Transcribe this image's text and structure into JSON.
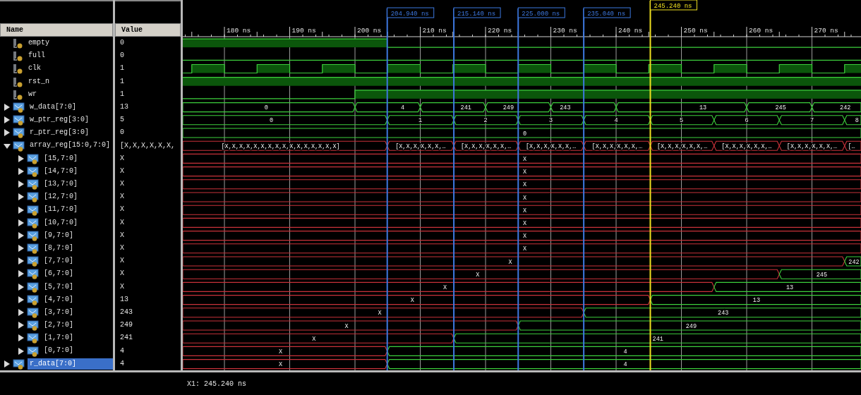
{
  "columns": {
    "name": "Name",
    "value": "Value"
  },
  "ruler": {
    "ticks": [
      "180 ns",
      "190 ns",
      "200 ns",
      "210 ns",
      "220 ns",
      "230 ns",
      "240 ns",
      "250 ns",
      "260 ns",
      "270 ns"
    ]
  },
  "markers": [
    {
      "label": "204.940 ns",
      "kind": "marker"
    },
    {
      "label": "215.140 ns",
      "kind": "marker"
    },
    {
      "label": "225.000 ns",
      "kind": "marker"
    },
    {
      "label": "235.040 ns",
      "kind": "marker"
    },
    {
      "label": "245.240 ns",
      "kind": "cursor"
    }
  ],
  "signals": [
    {
      "name": "empty",
      "kind": "bit",
      "value": "0",
      "selected": false
    },
    {
      "name": "full",
      "kind": "bit",
      "value": "0",
      "selected": false
    },
    {
      "name": "clk",
      "kind": "bit",
      "value": "1",
      "selected": false
    },
    {
      "name": "rst_n",
      "kind": "bit",
      "value": "1",
      "selected": false
    },
    {
      "name": "wr",
      "kind": "bit",
      "value": "1",
      "selected": false
    },
    {
      "name": "w_data[7:0]",
      "kind": "bus",
      "value": "13",
      "expanded": false,
      "selected": false,
      "labels": [
        "0",
        "4",
        "241",
        "249",
        "243",
        "13",
        "245",
        "242"
      ]
    },
    {
      "name": "w_ptr_reg[3:0]",
      "kind": "bus",
      "value": "5",
      "expanded": false,
      "selected": false,
      "labels": [
        "0",
        "1",
        "2",
        "3",
        "4",
        "5",
        "6",
        "7",
        "8"
      ]
    },
    {
      "name": "r_ptr_reg[3:0]",
      "kind": "bus",
      "value": "0",
      "expanded": false,
      "selected": false,
      "labels": [
        "0"
      ]
    },
    {
      "name": "array_reg[15:0,7:0]",
      "kind": "bus",
      "value": "[X,X,X,X,X,X,",
      "expanded": true,
      "selected": false,
      "labels": [
        "[X,X,X,X,X,X,X,X,X,X,X,X,X,X,X,X]",
        "[X,X,X,X,X,X,…",
        "[X,X,X,X,X,X,…",
        "[X,X,X,X,X,X,…",
        "[X,X,X,X,X,X,…",
        "[X,X,X,X,X,X,…",
        "[X,X,X,X,X,X,…",
        "[X,X,X,X,X,X,…",
        "[…"
      ],
      "children": [
        {
          "name": "[15,7:0]",
          "kind": "bus",
          "value": "X",
          "expanded": false,
          "selected": false,
          "labels": [
            "X"
          ]
        },
        {
          "name": "[14,7:0]",
          "kind": "bus",
          "value": "X",
          "expanded": false,
          "selected": false,
          "labels": [
            "X"
          ]
        },
        {
          "name": "[13,7:0]",
          "kind": "bus",
          "value": "X",
          "expanded": false,
          "selected": false,
          "labels": [
            "X"
          ]
        },
        {
          "name": "[12,7:0]",
          "kind": "bus",
          "value": "X",
          "expanded": false,
          "selected": false,
          "labels": [
            "X"
          ]
        },
        {
          "name": "[11,7:0]",
          "kind": "bus",
          "value": "X",
          "expanded": false,
          "selected": false,
          "labels": [
            "X"
          ]
        },
        {
          "name": "[10,7:0]",
          "kind": "bus",
          "value": "X",
          "expanded": false,
          "selected": false,
          "labels": [
            "X"
          ]
        },
        {
          "name": "[9,7:0]",
          "kind": "bus",
          "value": "X",
          "expanded": false,
          "selected": false,
          "labels": [
            "X"
          ]
        },
        {
          "name": "[8,7:0]",
          "kind": "bus",
          "value": "X",
          "expanded": false,
          "selected": false,
          "labels": [
            "X"
          ]
        },
        {
          "name": "[7,7:0]",
          "kind": "bus",
          "value": "X",
          "expanded": false,
          "selected": false,
          "labels": [
            "X",
            "242"
          ]
        },
        {
          "name": "[6,7:0]",
          "kind": "bus",
          "value": "X",
          "expanded": false,
          "selected": false,
          "labels": [
            "X",
            "245"
          ]
        },
        {
          "name": "[5,7:0]",
          "kind": "bus",
          "value": "X",
          "expanded": false,
          "selected": false,
          "labels": [
            "X",
            "13"
          ]
        },
        {
          "name": "[4,7:0]",
          "kind": "bus",
          "value": "13",
          "expanded": false,
          "selected": false,
          "labels": [
            "X",
            "13"
          ]
        },
        {
          "name": "[3,7:0]",
          "kind": "bus",
          "value": "243",
          "expanded": false,
          "selected": false,
          "labels": [
            "X",
            "243"
          ]
        },
        {
          "name": "[2,7:0]",
          "kind": "bus",
          "value": "249",
          "expanded": false,
          "selected": false,
          "labels": [
            "X",
            "249"
          ]
        },
        {
          "name": "[1,7:0]",
          "kind": "bus",
          "value": "241",
          "expanded": false,
          "selected": false,
          "labels": [
            "X",
            "241"
          ]
        },
        {
          "name": "[0,7:0]",
          "kind": "bus",
          "value": "4",
          "expanded": false,
          "selected": false,
          "labels": [
            "X",
            "4"
          ]
        }
      ]
    },
    {
      "name": "r_data[7:0]",
      "kind": "bus",
      "value": "4",
      "expanded": false,
      "selected": true,
      "labels": [
        "X",
        "4"
      ]
    }
  ],
  "status": "X1: 245.240 ns"
}
